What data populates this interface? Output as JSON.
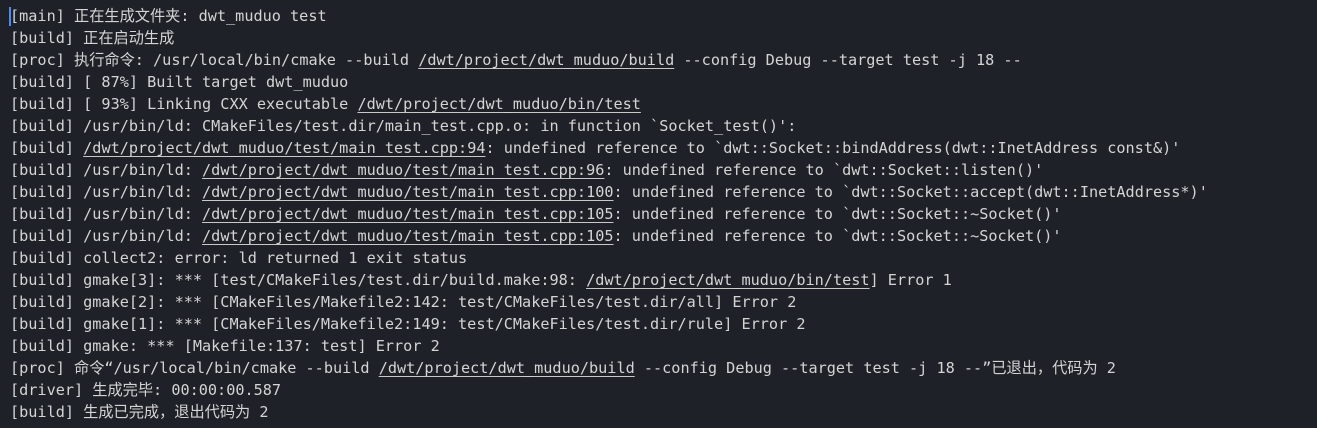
{
  "output": {
    "lines": [
      [
        {
          "text": "[main] 正在生成文件夹: dwt_muduo test"
        }
      ],
      [
        {
          "text": "[build] 正在启动生成"
        }
      ],
      [
        {
          "text": "[proc] 执行命令: /usr/local/bin/cmake --build "
        },
        {
          "text": "/dwt/project/dwt_muduo/build",
          "link": true
        },
        {
          "text": " --config Debug --target test -j 18 --"
        }
      ],
      [
        {
          "text": "[build] [ 87%] Built target dwt_muduo"
        }
      ],
      [
        {
          "text": "[build] [ 93%] Linking CXX executable "
        },
        {
          "text": "/dwt/project/dwt_muduo/bin/test",
          "link": true
        }
      ],
      [
        {
          "text": "[build] /usr/bin/ld: CMakeFiles/test.dir/main_test.cpp.o: in function `Socket_test()':"
        }
      ],
      [
        {
          "text": "[build] "
        },
        {
          "text": "/dwt/project/dwt_muduo/test/main_test.cpp:94",
          "link": true
        },
        {
          "text": ": undefined reference to `dwt::Socket::bindAddress(dwt::InetAddress const&)'"
        }
      ],
      [
        {
          "text": "[build] /usr/bin/ld: "
        },
        {
          "text": "/dwt/project/dwt_muduo/test/main_test.cpp:96",
          "link": true
        },
        {
          "text": ": undefined reference to `dwt::Socket::listen()'"
        }
      ],
      [
        {
          "text": "[build] /usr/bin/ld: "
        },
        {
          "text": "/dwt/project/dwt_muduo/test/main_test.cpp:100",
          "link": true
        },
        {
          "text": ": undefined reference to `dwt::Socket::accept(dwt::InetAddress*)'"
        }
      ],
      [
        {
          "text": "[build] /usr/bin/ld: "
        },
        {
          "text": "/dwt/project/dwt_muduo/test/main_test.cpp:105",
          "link": true
        },
        {
          "text": ": undefined reference to `dwt::Socket::~Socket()'"
        }
      ],
      [
        {
          "text": "[build] /usr/bin/ld: "
        },
        {
          "text": "/dwt/project/dwt_muduo/test/main_test.cpp:105",
          "link": true
        },
        {
          "text": ": undefined reference to `dwt::Socket::~Socket()'"
        }
      ],
      [
        {
          "text": "[build] collect2: error: ld returned 1 exit status"
        }
      ],
      [
        {
          "text": "[build] gmake[3]: *** [test/CMakeFiles/test.dir/build.make:98: "
        },
        {
          "text": "/dwt/project/dwt_muduo/bin/test",
          "link": true
        },
        {
          "text": "] Error 1"
        }
      ],
      [
        {
          "text": "[build] gmake[2]: *** [CMakeFiles/Makefile2:142: test/CMakeFiles/test.dir/all] Error 2"
        }
      ],
      [
        {
          "text": "[build] gmake[1]: *** [CMakeFiles/Makefile2:149: test/CMakeFiles/test.dir/rule] Error 2"
        }
      ],
      [
        {
          "text": "[build] gmake: *** [Makefile:137: test] Error 2"
        }
      ],
      [
        {
          "text": "[proc] 命令“/usr/local/bin/cmake --build "
        },
        {
          "text": "/dwt/project/dwt_muduo/build",
          "link": true
        },
        {
          "text": " --config Debug --target test -j 18 --”已退出，代码为 2"
        }
      ],
      [
        {
          "text": "[driver] 生成完毕: 00:00:00.587"
        }
      ],
      [
        {
          "text": "[build] 生成已完成，退出代码为 2"
        }
      ]
    ]
  }
}
